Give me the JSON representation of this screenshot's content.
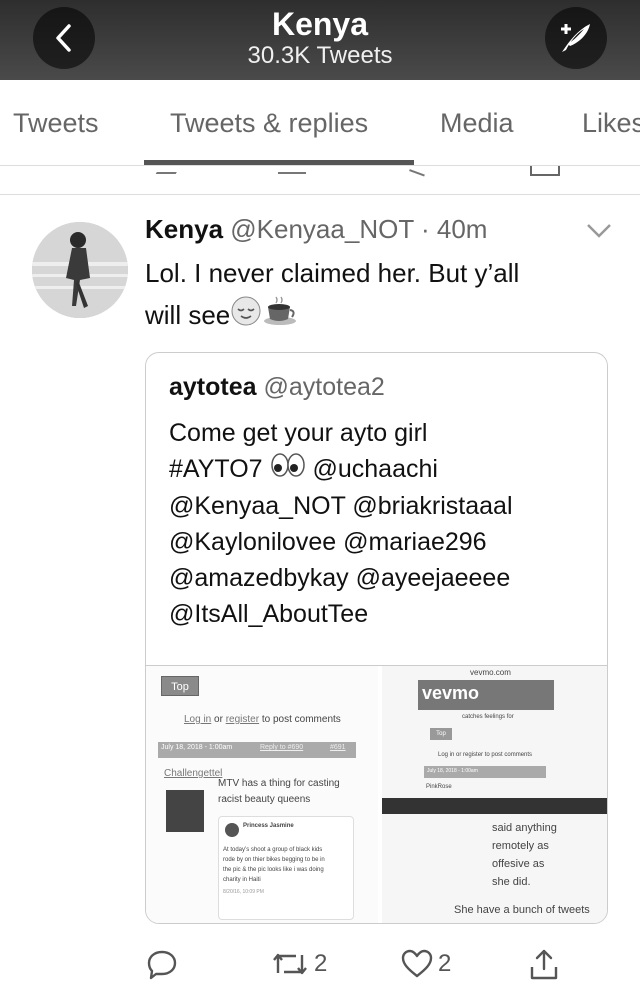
{
  "header": {
    "title": "Kenya",
    "subtitle": "30.3K Tweets",
    "back_icon": "chevron-left-icon",
    "compose_icon": "compose-quill-icon"
  },
  "tabs": [
    {
      "label": "Tweets"
    },
    {
      "label": "Tweets & replies",
      "selected": true
    },
    {
      "label": "Media"
    },
    {
      "label": "Likes"
    }
  ],
  "tweet": {
    "name": "Kenya",
    "handle": "@Kenyaa_NOT",
    "separator": "·",
    "time": "40m",
    "text_line1": "Lol. I never claimed her. But y’all",
    "text_line2": "will see",
    "emojis": [
      "relieved-face-icon",
      "coffee-cup-icon"
    ]
  },
  "quote": {
    "name": "aytotea",
    "handle": "@aytotea2",
    "lines": [
      "Come get your ayto girl",
      "#AYTO7",
      "@uchaachi",
      "@Kenyaa_NOT @briakristaaal",
      "@Kaylonilovee @mariae296",
      "@amazedbykay @ayeejaeeee",
      "@ItsAll_AboutTee"
    ],
    "eyes_icon": "eyes-icon",
    "media_left": {
      "top_button": "Top",
      "login_link": "Log in",
      "or": "or",
      "register_link": "register",
      "post_comments": "to post comments",
      "date": "July 18, 2018 - 1:00am",
      "reply_to": "Reply to #690",
      "num": "#691",
      "user": "Challengettel",
      "comment_line1": "MTV has a thing for casting",
      "comment_line2": "racist beauty queens",
      "embed_name": "Princess Jasmine",
      "embed_text1": "At today’s shoot a group of black kids",
      "embed_text2": "rode by on thier bikes begging to be in",
      "embed_text3": "the pic & the pic looks like i was doing",
      "embed_text4": "charity in Haiti",
      "embed_date": "8/20/16, 10:09 PM"
    },
    "media_right": {
      "site": "vevmo.com",
      "logo": "vevmo",
      "tagline": "catches feelings for",
      "top_button": "Top",
      "post_comments": "Log in or register to post comments",
      "date": "July 18, 2018 - 1:00am",
      "user": "PinkRose",
      "overlay_line1": "said anything",
      "overlay_line2": "remotely as",
      "overlay_line3": "offesive as",
      "overlay_line4": "she did.",
      "bottom_text": "She have a bunch of tweets"
    }
  },
  "actions": {
    "reply_icon": "reply-bubble-icon",
    "retweet_icon": "retweet-icon",
    "retweet_count": "2",
    "like_icon": "heart-icon",
    "like_count": "2",
    "share_icon": "share-icon"
  }
}
